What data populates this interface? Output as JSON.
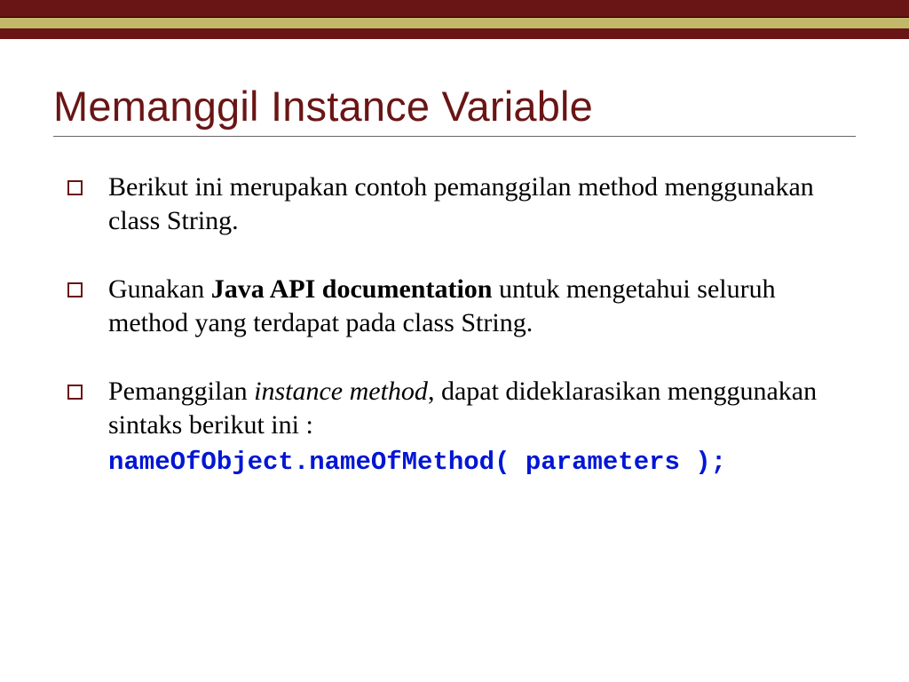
{
  "title": "Memanggil Instance Variable",
  "bullets": {
    "b1": "Berikut ini merupakan contoh pemanggilan method menggunakan class String.",
    "b2_pre": "Gunakan ",
    "b2_bold": "Java API documentation",
    "b2_post": " untuk mengetahui seluruh method yang terdapat pada class String.",
    "b3_pre": "Pemanggilan ",
    "b3_italic": "instance method",
    "b3_post": ", dapat dideklarasikan menggunakan sintaks berikut ini :",
    "b3_code": "nameOfObject.nameOfMethod( parameters );"
  }
}
